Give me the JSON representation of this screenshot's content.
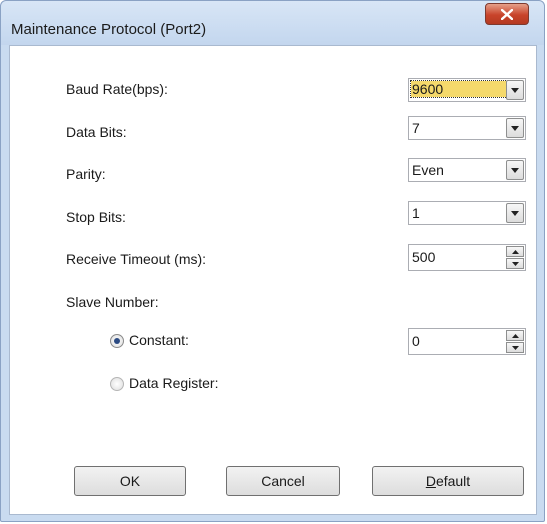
{
  "window": {
    "title": "Maintenance Protocol (Port2)",
    "close_glyph": "✕"
  },
  "fields": {
    "baud_rate": {
      "label": "Baud Rate(bps):",
      "value": "9600"
    },
    "data_bits": {
      "label": "Data Bits:",
      "value": "7"
    },
    "parity": {
      "label": "Parity:",
      "value": "Even"
    },
    "stop_bits": {
      "label": "Stop Bits:",
      "value": "1"
    },
    "receive_timeout": {
      "label": "Receive Timeout (ms):",
      "value": "500"
    },
    "slave_number": {
      "label": "Slave Number:",
      "constant": {
        "label": "Constant:",
        "value": "0",
        "selected": true
      },
      "data_register": {
        "label": "Data Register:",
        "selected": false
      }
    }
  },
  "buttons": {
    "ok": "OK",
    "cancel": "Cancel",
    "default": "Default"
  },
  "icons": {
    "dropdown": "chevron-down-icon",
    "spin_up": "spin-up-icon",
    "spin_down": "spin-down-icon"
  },
  "colors": {
    "focus_highlight": "#f5d96b",
    "close_button": "#c8442b",
    "frame": "#c9dbf0"
  }
}
